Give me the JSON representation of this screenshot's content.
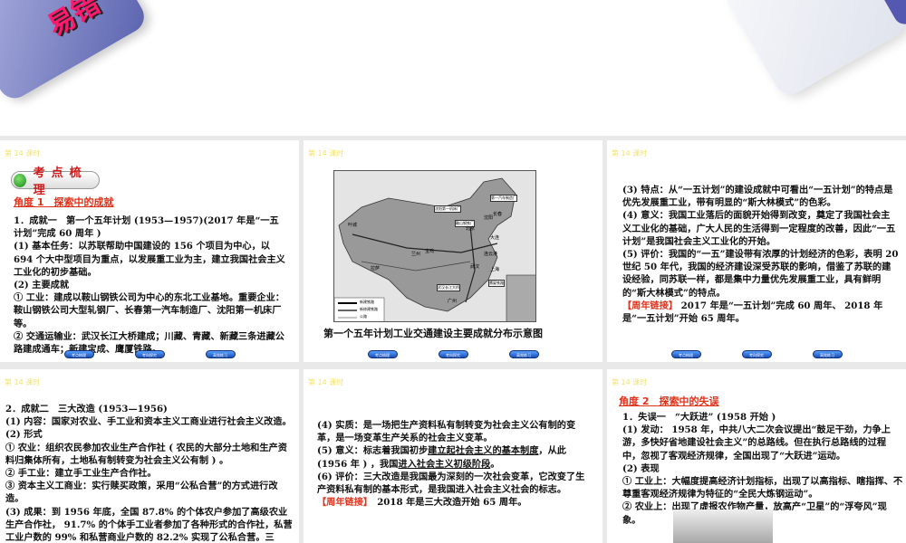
{
  "top_slide": {
    "title_fragment": "易错"
  },
  "common": {
    "lesson_tag": "第 14 课时",
    "nav_buttons": [
      "考点梳理",
      "考向探究",
      "高效练习"
    ]
  },
  "slides": [
    {
      "badge": "考点梳理",
      "heading": "角度 1　探索中的成就",
      "lines": [
        "1．成就一　第一个五年计划 (1953—1957)(2017 年是“一五计划”完成 60 周年 )",
        "(1) 基本任务：以苏联帮助中国建设的 156 个项目为中心，以 694 个大中型项目为重点，以发展重工业为主，建立我国社会主义工业化的初步基础。",
        "(2) 主要成就",
        "① 工业：建成以鞍山钢铁公司为中心的东北工业基地。重要企业：鞍山钢铁公司大型轧钢厂、长春第一汽车制造厂、沈阳第一机床厂等。",
        "② 交通运输业：武汉长江大桥建成；川藏、青藏、新藏三条进藏公路建成通车；新建宝成、鹰厦铁路。"
      ]
    },
    {
      "map_labels": [
        "第一汽车制造厂",
        "沈阳第一机床厂",
        "鞍山钢铁厂",
        "长春",
        "沈阳",
        "北京",
        "大连",
        "兰州",
        "宝鸡",
        "武汉",
        "上海",
        "广州",
        "拉萨",
        "叶城",
        "连云港",
        "武汉长江大桥",
        "鹰厦铁路"
      ],
      "legend": [
        "新建铁路",
        "新修建铁路",
        "公路"
      ],
      "caption": "第一个五年计划工业交通建设主要成就分布示意图"
    },
    {
      "lines": [
        "(3) 特点：从“一五计划”的建设成就中可看出“一五计划”的特点是优先发展重工业，带有明显的“斯大林模式”的色彩。",
        "(4) 意义：我国工业落后的面貌开始得到改变，奠定了我国社会主义工业化的基础，广大人民的生活得到一定程度的改善，因此“一五计划”是我国社会主义工业化的开始。",
        "(5) 评价：我国的“一五”建设带有浓厚的计划经济的色彩，表明 20 世纪 50 年代，我国的经济建设深受苏联的影响，借鉴了苏联的建设经验，同苏联一样，都是集中力量优先发展重工业，具有鲜明的“斯大林模式”的特点。"
      ],
      "link_label": "【周年链接】",
      "link_text": "2017 年是“一五计划”完成 60 周年、 2018 年是“一五计划”开始 65 周年。"
    },
    {
      "lines": [
        "2．成就二　三大改造 (1953—1956)",
        "(1) 内容：国家对农业、手工业和资本主义工商业进行社会主义改造。",
        "(2) 形式",
        "① 农业：组织农民参加农业生产合作社 ( 农民的大部分土地和生产资料归集体所有，土地私有制转变为社会主义公有制 ) 。",
        "② 手工业：建立手工业生产合作社。",
        "③ 资本主义工商业：实行赎买政策，采用“公私合营”的方式进行改造。",
        "(3) 成果：到 1956 年底，全国 87.8% 的个体农户参加了高级农业生产合作社， 91.7% 的个体手工业者参加了各种形式的合作社，私营工业户数的 99% 和私营商业户数的 82.2% 实现了公私合营。三"
      ]
    },
    {
      "l1": "(4) 实质：是一场把生产资料私有制转变为社会主义公有制的变革，是一场变革生产关系的社会主义变革。",
      "l2a": "(5) 意义：标志着我国初步",
      "l2b": "建立起社会主义的基本制度",
      "l2c": "，从此 (1956 年 ) ，我国",
      "l2d": "进入社会主义初级阶段",
      "l2e": "。",
      "l3": "(6) 评价：三大改造是我国最为深刻的一次社会变革，它改变了生产资料私有制的基本形式，是我国进入社会主义社会的标志。",
      "link_label": "【周年链接】",
      "link_text": "2018 年是三大改造开始 65 周年。"
    },
    {
      "heading": "角度 2　探索中的失误",
      "lines": [
        "1．失误一　“大跃进” (1958 开始 )",
        "(1) 发动： 1958 年，中共八大二次会议提出“鼓足干劲，力争上游，多快好省地建设社会主义”的总路线。但在执行总路线的过程中，忽视了客观经济规律，全国出现了“大跃进”运动。",
        "(2) 表现",
        "① 工业上：大幅度提高经济计划指标，出现了以高指标、瞎指挥、不尊重客观经济规律为特征的“全民大炼钢运动”。",
        "② 农业上：出现了虚报农作物产量，放高产“卫星”的“浮夸风”现象。"
      ]
    }
  ]
}
